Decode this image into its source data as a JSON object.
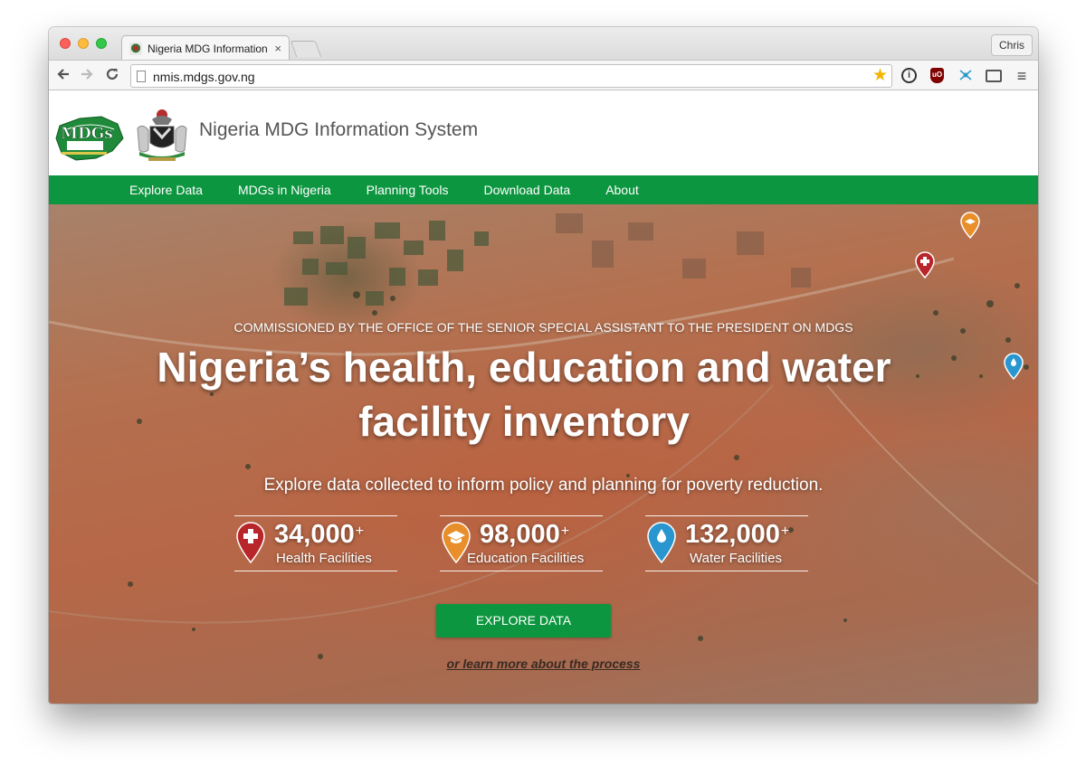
{
  "browser": {
    "tab_title": "Nigeria MDG Information S",
    "tab_close": "×",
    "profile_name": "Chris",
    "url": "nmis.mdgs.gov.ng",
    "back_icon": "arrow-left-icon",
    "forward_icon": "arrow-right-icon",
    "reload_icon": "reload-icon",
    "bookmark_icon": "star-icon",
    "menu_icon": "hamburger-menu-icon"
  },
  "site": {
    "title": "Nigeria MDG Information System",
    "nav": [
      {
        "label": "Explore Data"
      },
      {
        "label": "MDGs in Nigeria"
      },
      {
        "label": "Planning Tools"
      },
      {
        "label": "Download Data"
      },
      {
        "label": "About"
      }
    ],
    "brand_color": "#0d9640"
  },
  "hero": {
    "commissioned": "COMMISSIONED BY THE OFFICE OF THE SENIOR SPECIAL ASSISTANT TO THE PRESIDENT ON MDGS",
    "headline": "Nigeria’s health, education and water facility inventory",
    "subline": "Explore data collected to inform policy and planning for poverty reduction.",
    "stats": [
      {
        "number": "34,000",
        "plus": "+",
        "label": "Health Facilities",
        "icon": "health-pin-icon",
        "color": "#b8262b"
      },
      {
        "number": "98,000",
        "plus": "+",
        "label": "Education Facilities",
        "icon": "education-pin-icon",
        "color": "#e88e2a"
      },
      {
        "number": "132,000",
        "plus": "+",
        "label": "Water Facilities",
        "icon": "water-pin-icon",
        "color": "#2a96cf"
      }
    ],
    "cta_label": "EXPLORE DATA",
    "learn_more": "or learn more about the process"
  }
}
